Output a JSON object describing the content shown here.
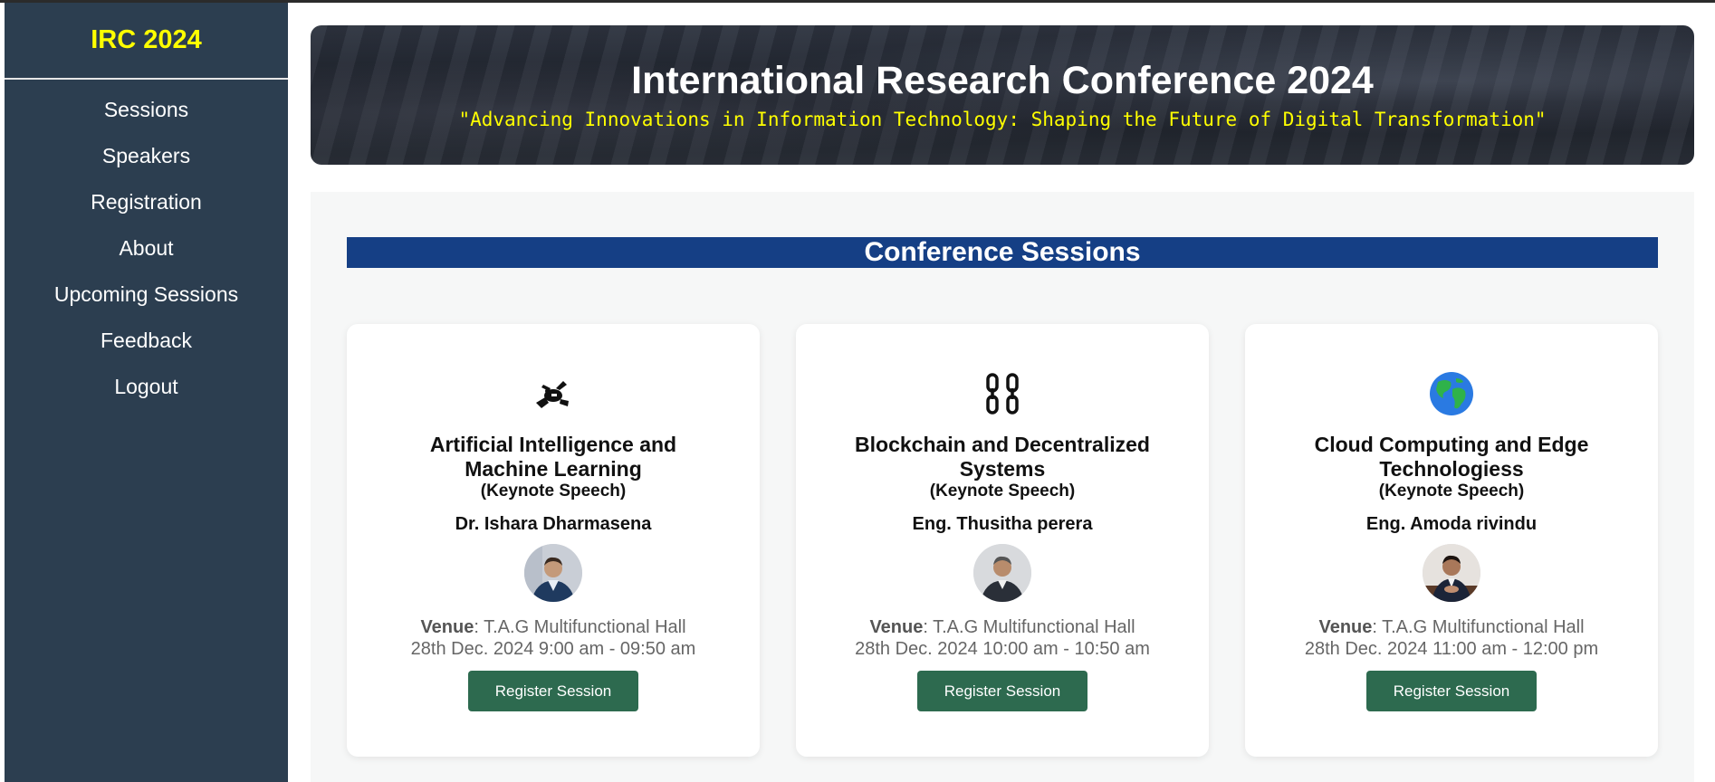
{
  "sidebar": {
    "brand": "IRC 2024",
    "items": [
      {
        "label": "Sessions"
      },
      {
        "label": "Speakers"
      },
      {
        "label": "Registration"
      },
      {
        "label": "About"
      },
      {
        "label": "Upcoming Sessions"
      },
      {
        "label": "Feedback"
      },
      {
        "label": "Logout"
      }
    ]
  },
  "hero": {
    "title": "International Research Conference 2024",
    "tagline": "\"Advancing Innovations in Information Technology: Shaping the Future of Digital Transformation\""
  },
  "section": {
    "title": "Conference Sessions"
  },
  "sessions": [
    {
      "icon": "robot-icon",
      "title": "Artificial Intelligence and Machine Learning",
      "kind": "(Keynote Speech)",
      "speaker": "Dr. Ishara Dharmasena",
      "venue_label": "Venue",
      "venue": ": T.A.G Multifunctional Hall",
      "time": "28th Dec. 2024 9:00 am - 09:50 am",
      "button": "Register Session"
    },
    {
      "icon": "chain-link-icon",
      "title": "Blockchain and Decentralized Systems",
      "kind": "(Keynote Speech)",
      "speaker": "Eng. Thusitha perera",
      "venue_label": "Venue",
      "venue": ": T.A.G Multifunctional Hall",
      "time": "28th Dec. 2024 10:00 am - 10:50 am",
      "button": "Register Session"
    },
    {
      "icon": "globe-icon",
      "title": "Cloud Computing and Edge Technologiess",
      "kind": "(Keynote Speech)",
      "speaker": "Eng. Amoda rivindu",
      "venue_label": "Venue",
      "venue": ": T.A.G Multifunctional Hall",
      "time": "28th Dec. 2024 11:00 am - 12:00 pm",
      "button": "Register Session"
    }
  ],
  "colors": {
    "sidebar_bg": "#2c3e50",
    "brand": "#ffff00",
    "section_bar": "#153f85",
    "button": "#2d6a4f"
  }
}
